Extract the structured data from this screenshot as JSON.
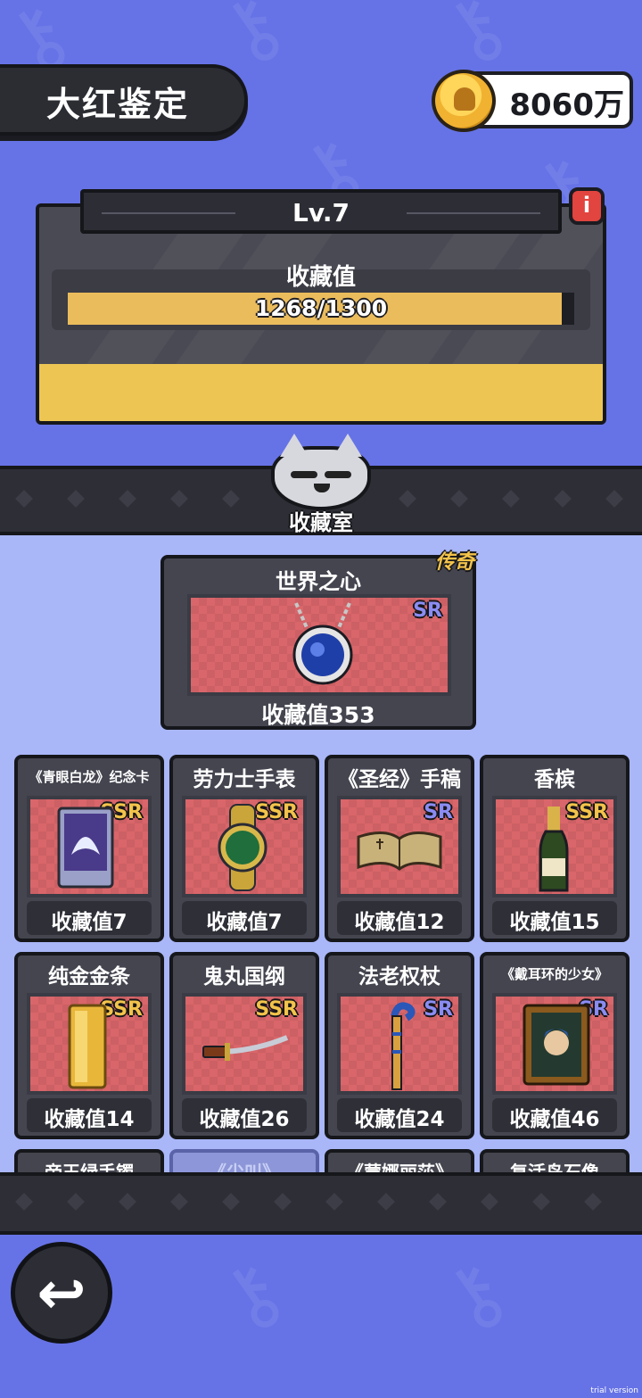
{
  "header": {
    "title": "大红鉴定",
    "coins": "8060万",
    "coin_icon": "skull-coin"
  },
  "level": {
    "label": "Lv.7",
    "info_label": "i",
    "collect_label": "收藏值",
    "progress_text": "1268/1300",
    "progress_fraction": 0.975
  },
  "room": {
    "label": "收藏室"
  },
  "featured": {
    "badge": "传奇",
    "title": "世界之心",
    "rarity": "SR",
    "value": "收藏值353",
    "icon": "sapphire-necklace-icon"
  },
  "items": [
    {
      "title": "《青眼白龙》纪念卡",
      "rarity": "SSR",
      "value": "收藏值7",
      "icon": "dragon-card-icon"
    },
    {
      "title": "劳力士手表",
      "rarity": "SSR",
      "value": "收藏值7",
      "icon": "watch-icon"
    },
    {
      "title": "《圣经》手稿",
      "rarity": "SR",
      "value": "收藏值12",
      "icon": "open-book-icon"
    },
    {
      "title": "香槟",
      "rarity": "SSR",
      "value": "收藏值15",
      "icon": "champagne-icon"
    },
    {
      "title": "纯金金条",
      "rarity": "SSR",
      "value": "收藏值14",
      "icon": "gold-bar-icon"
    },
    {
      "title": "鬼丸国纲",
      "rarity": "SSR",
      "value": "收藏值26",
      "icon": "katana-icon"
    },
    {
      "title": "法老权杖",
      "rarity": "SR",
      "value": "收藏值24",
      "icon": "scepter-icon"
    },
    {
      "title": "《戴耳环的少女》",
      "rarity": "SR",
      "value": "收藏值46",
      "icon": "painting-icon"
    }
  ],
  "partial_items": [
    "帝王绿手镯",
    "《尖叫》",
    "《蒙娜丽莎》",
    "复活岛石像"
  ],
  "back_label": "↩",
  "footer_note": "trial version",
  "colors": {
    "background": "#6673e6",
    "panel": "#44454f",
    "gold": "#f3c34a",
    "ssr": "#f3c34a",
    "sr": "#8b8cf2",
    "art_red": "#d9666a"
  }
}
